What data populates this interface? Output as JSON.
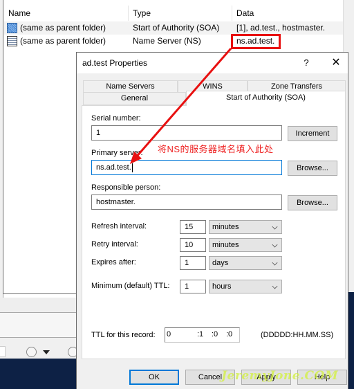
{
  "list": {
    "columns": [
      "Name",
      "Type",
      "Data"
    ],
    "rows": [
      {
        "icon": "soa-record-icon",
        "name": "(same as parent folder)",
        "type": "Start of Authority (SOA)",
        "data": "[1], ad.test., hostmaster."
      },
      {
        "icon": "ns-record-icon",
        "name": "(same as parent folder)",
        "type": "Name Server (NS)",
        "data": "ns.ad.test."
      }
    ]
  },
  "dialog": {
    "title": "ad.test Properties",
    "help_glyph": "?",
    "close_glyph": "✕",
    "tabs": {
      "name_servers": "Name Servers",
      "wins": "WINS",
      "zone_transfers": "Zone Transfers",
      "general": "General",
      "soa": "Start of Authority (SOA)"
    },
    "active_tab": "Start of Authority (SOA)",
    "serial": {
      "label": "Serial number:",
      "value": "1",
      "button": "Increment"
    },
    "primary_server": {
      "label": "Primary server:",
      "value": "ns.ad.test.",
      "button": "Browse..."
    },
    "responsible_person": {
      "label": "Responsible person:",
      "value": "hostmaster.",
      "button": "Browse..."
    },
    "refresh": {
      "label": "Refresh interval:",
      "value": "15",
      "unit": "minutes"
    },
    "retry": {
      "label": "Retry interval:",
      "value": "10",
      "unit": "minutes"
    },
    "expires": {
      "label": "Expires after:",
      "value": "1",
      "unit": "days"
    },
    "min_ttl": {
      "label": "Minimum (default) TTL:",
      "value": "1",
      "unit": "hours"
    },
    "ttl_record": {
      "label": "TTL for this record:",
      "days": "0",
      "hours": ":1",
      "minutes": ":0",
      "seconds": ":0",
      "format": "(DDDDD:HH.MM.SS)"
    },
    "buttons": {
      "ok": "OK",
      "cancel": "Cancel",
      "apply": "Apply",
      "help": "Help"
    }
  },
  "annotation": {
    "text": "将NS的服务器域名填入此处",
    "color": "#e81010"
  },
  "watermark": "JeremyJone.COM"
}
